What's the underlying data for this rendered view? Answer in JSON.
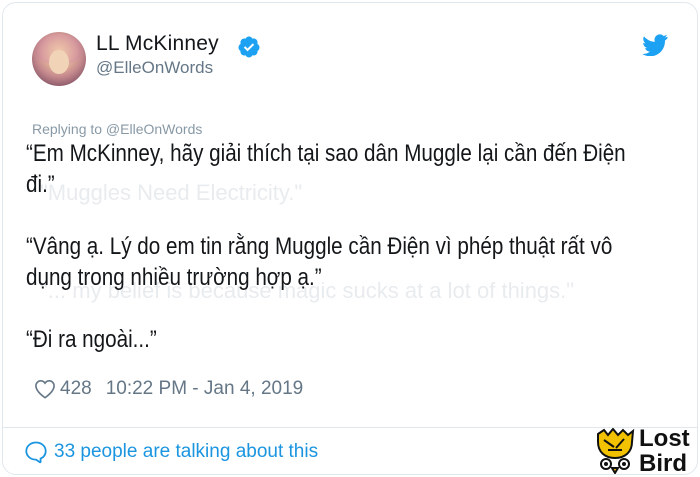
{
  "author": {
    "name": "LL McKinney",
    "handle": "@ElleOnWords",
    "verified": true
  },
  "replying_to": "Replying to @ElleOnWords",
  "tweet": {
    "lines": [
      "“Em McKinney, hãy giải thích tại sao dân Muggle lại cần đến Điện",
      "đi.”",
      "“Vâng ạ. Lý do em tin rằng Muggle cần Điện vì phép thuật rất vô",
      "dụng trong nhiều trường hợp ạ.”",
      "“Đi ra ngoài...”"
    ]
  },
  "ghost_text": {
    "line1": "\"Muggles Need Electricity.\"",
    "line2": "\"... my belief is because magic sucks at a lot of things.\""
  },
  "stats": {
    "likes": "428",
    "timestamp": "10:22 PM - Jan 4, 2019"
  },
  "talking": "33 people are talking about this",
  "watermark": {
    "line1": "Lost",
    "line2": "Bird"
  },
  "colors": {
    "accent": "#1da1f2",
    "link": "#1b95e0",
    "secondary_text": "#657786"
  },
  "icons": {
    "verified": "verified-badge-icon",
    "twitter": "twitter-bird-icon",
    "like": "heart-outline-icon",
    "comments": "speech-bubble-icon"
  }
}
